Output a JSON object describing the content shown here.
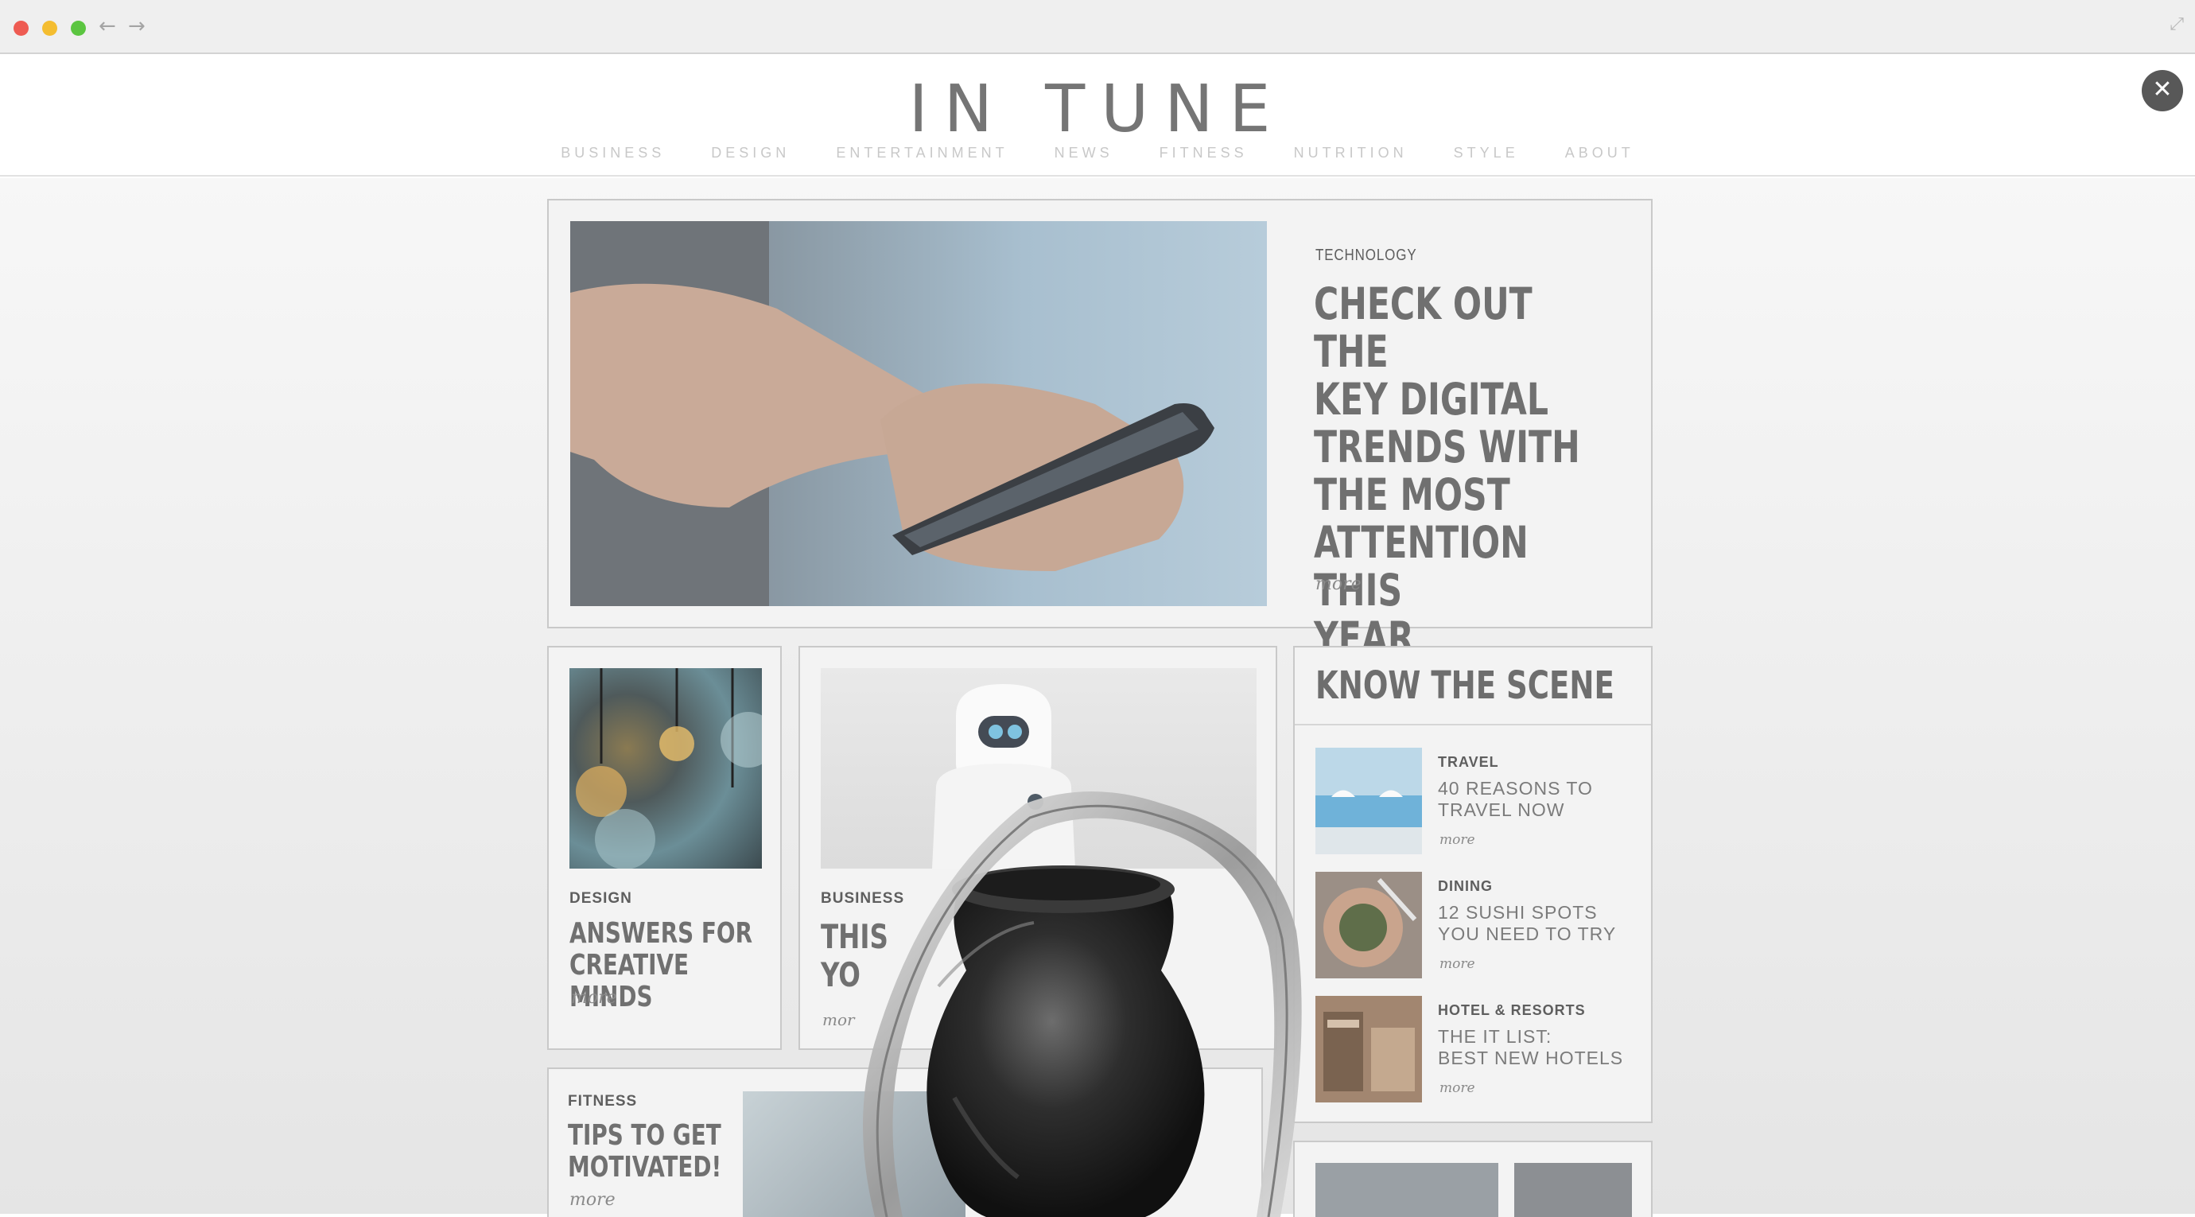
{
  "browser": {
    "back_icon": "arrow-left-icon",
    "forward_icon": "arrow-right-icon",
    "expand_icon": "expand-icon",
    "back_glyph": "←",
    "forward_glyph": "→",
    "expand_glyph": "⤢"
  },
  "site": {
    "logo": "IN TUNE",
    "close_glyph": "✕",
    "nav": [
      "BUSINESS",
      "DESIGN",
      "ENTERTAINMENT",
      "NEWS",
      "FITNESS",
      "NUTRITION",
      "STYLE",
      "ABOUT"
    ]
  },
  "hero": {
    "category": "TECHNOLOGY",
    "title": "CHECK OUT THE\nKEY DIGITAL\nTRENDS WITH\nTHE MOST\nATTENTION THIS\nYEAR",
    "more": "more"
  },
  "design_card": {
    "category": "DESIGN",
    "title": "ANSWERS FOR\nCREATIVE MINDS",
    "more": "more"
  },
  "business_card": {
    "category": "BUSINESS",
    "title": "THIS\nYO",
    "more": "mor"
  },
  "fitness_card": {
    "category": "FITNESS",
    "title": "TIPS TO GET\nMOTIVATED!",
    "more": "more"
  },
  "scene": {
    "heading": "KNOW THE SCENE",
    "items": [
      {
        "category": "TRAVEL",
        "title": "40 REASONS TO\nTRAVEL NOW",
        "more": "more"
      },
      {
        "category": "DINING",
        "title": "12 SUSHI SPOTS\nYOU NEED TO TRY",
        "more": "more"
      },
      {
        "category": "HOTEL & RESORTS",
        "title": "THE IT LIST:\nBEST NEW HOTELS",
        "more": "more"
      }
    ]
  }
}
